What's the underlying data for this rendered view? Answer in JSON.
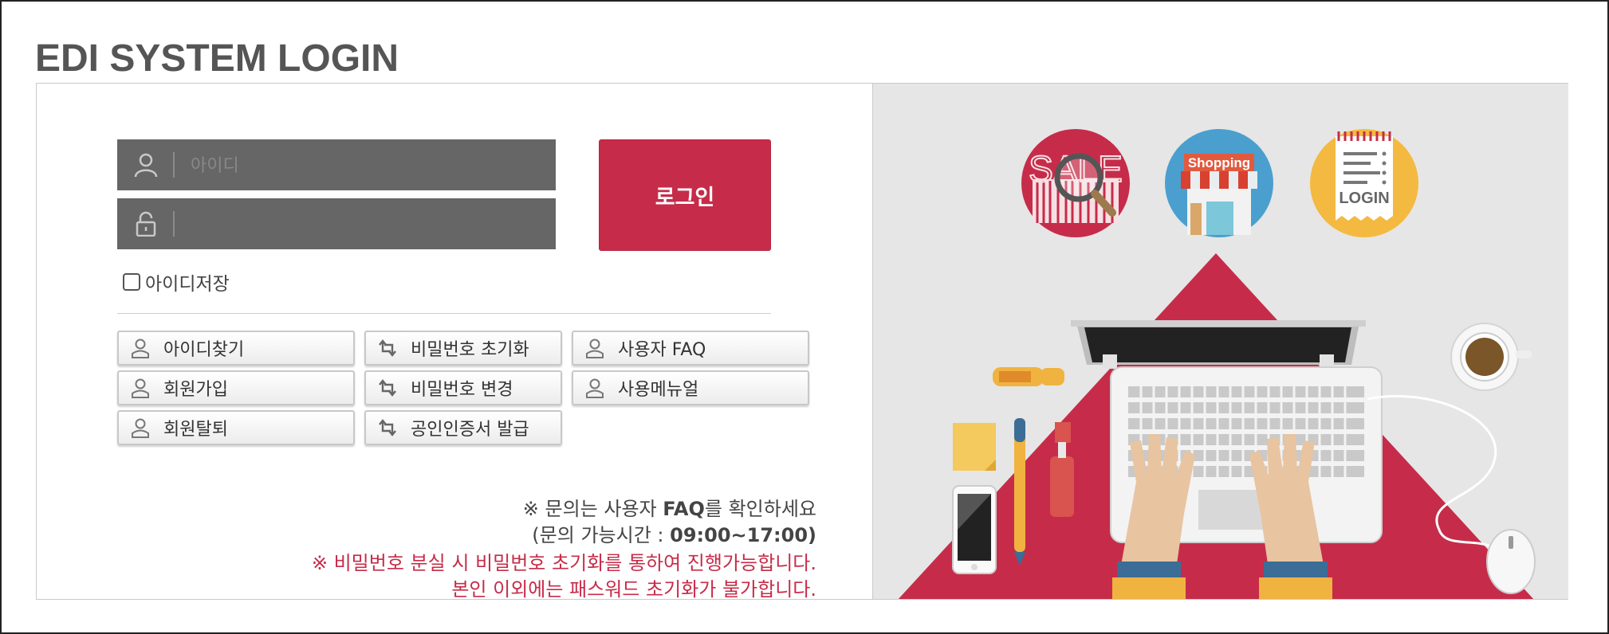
{
  "page_title": "EDI SYSTEM LOGIN",
  "login_form": {
    "id_placeholder": "아이디",
    "password_placeholder": "",
    "login_button": "로그인",
    "save_id_label": "아이디저장",
    "save_id_checked": false
  },
  "links": {
    "find_id": "아이디찾기",
    "reset_password": "비밀번호 초기화",
    "user_faq": "사용자 FAQ",
    "sign_up": "회원가입",
    "change_password": "비밀번호 변경",
    "user_manual": "사용메뉴얼",
    "withdraw": "회원탈퇴",
    "issue_certificate": "공인인증서 발급"
  },
  "notices": {
    "faq_prefix": "※ 문의는 사용자 ",
    "faq_strong": "FAQ",
    "faq_suffix": "를 확인하세요",
    "hours_prefix": "(문의 가능시간 : ",
    "hours_value": "09:00~17:00)",
    "lost_password_line1": "※ 비밀번호 분실 시 비밀번호 초기화를 통하여 진행가능합니다.",
    "lost_password_line2": "본인 이외에는 패스워드 초기화가 불가합니다."
  },
  "illustration": {
    "sale_text": "SALE",
    "shopping_text": "Shopping",
    "login_text": "LOGIN"
  },
  "colors": {
    "accent": "#c62c49",
    "field_bg": "#666666",
    "illustration_bg": "#e6e6e6"
  }
}
